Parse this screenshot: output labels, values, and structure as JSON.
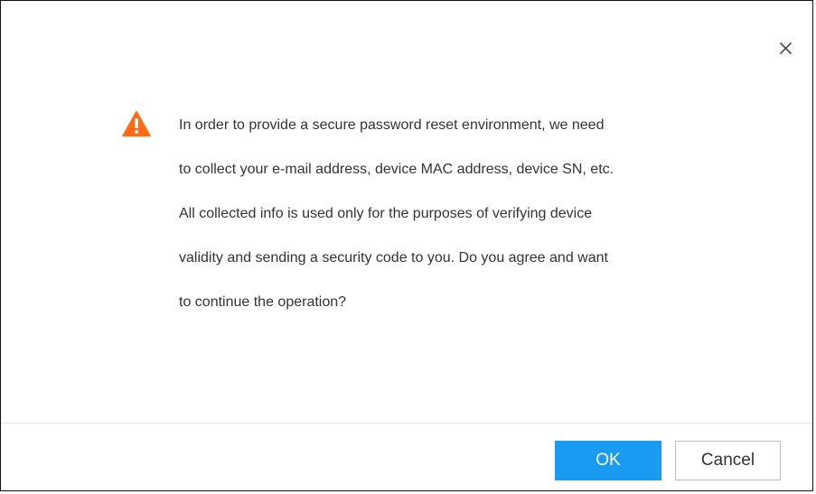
{
  "dialog": {
    "close_icon": "close-icon",
    "warning_icon": "warning-triangle-icon",
    "warning_color": "#ff6a13",
    "message_lines": [
      "In order to provide a secure password reset environment, we need",
      "to collect your e-mail address, device MAC address, device SN, etc.",
      "All collected info is used only for the purposes of verifying device",
      "validity and sending a security code to you. Do you agree and want",
      "to continue the operation?"
    ],
    "ok_label": "OK",
    "cancel_label": "Cancel",
    "ok_color": "#1a9bf2"
  }
}
